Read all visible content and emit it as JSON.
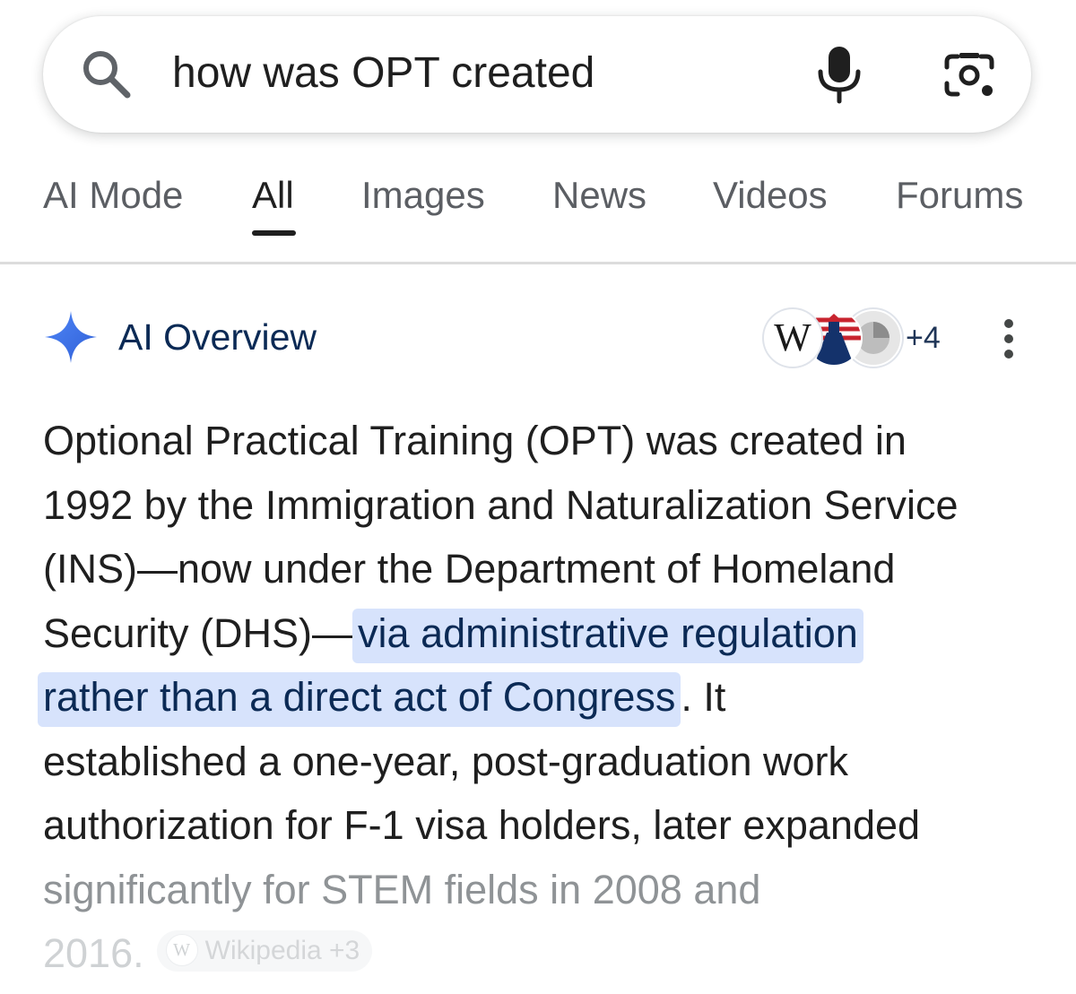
{
  "search": {
    "query": "how was OPT created"
  },
  "tabs": [
    {
      "label": "AI Mode"
    },
    {
      "label": "All",
      "active": true
    },
    {
      "label": "Images"
    },
    {
      "label": "News"
    },
    {
      "label": "Videos"
    },
    {
      "label": "Forums"
    }
  ],
  "ai_overview": {
    "title": "AI Overview",
    "sources": [
      "Wikipedia",
      "lighthouse-source",
      "gray-source"
    ],
    "more_sources_label": "+4",
    "lines": [
      "Optional Practical Training (OPT) was created in",
      "1992 by the Immigration and Naturalization Service",
      "(INS)—now under the Department of Homeland",
      "Security (DHS)—",
      "via administrative regulation",
      "rather than a direct act of Congress",
      ". It",
      "established a one-year, post-graduation work",
      "authorization for F-1 visa holders, later expanded",
      "significantly for STEM fields in 2008 and",
      "2016."
    ],
    "citation_chip": {
      "icon_letter": "W",
      "label": "Wikipedia +3"
    }
  },
  "colors": {
    "highlight_bg": "#d7e3fc",
    "highlight_text": "#0b2a55",
    "spark_blue": "#3e6fe8",
    "tab_active": "#1f1f1f",
    "tab_inactive": "#5b5e63"
  },
  "icons": {
    "search": "search-icon",
    "mic": "mic-icon",
    "lens": "lens-camera-icon",
    "spark": "gemini-spark-icon",
    "menu": "kebab-menu-icon"
  }
}
